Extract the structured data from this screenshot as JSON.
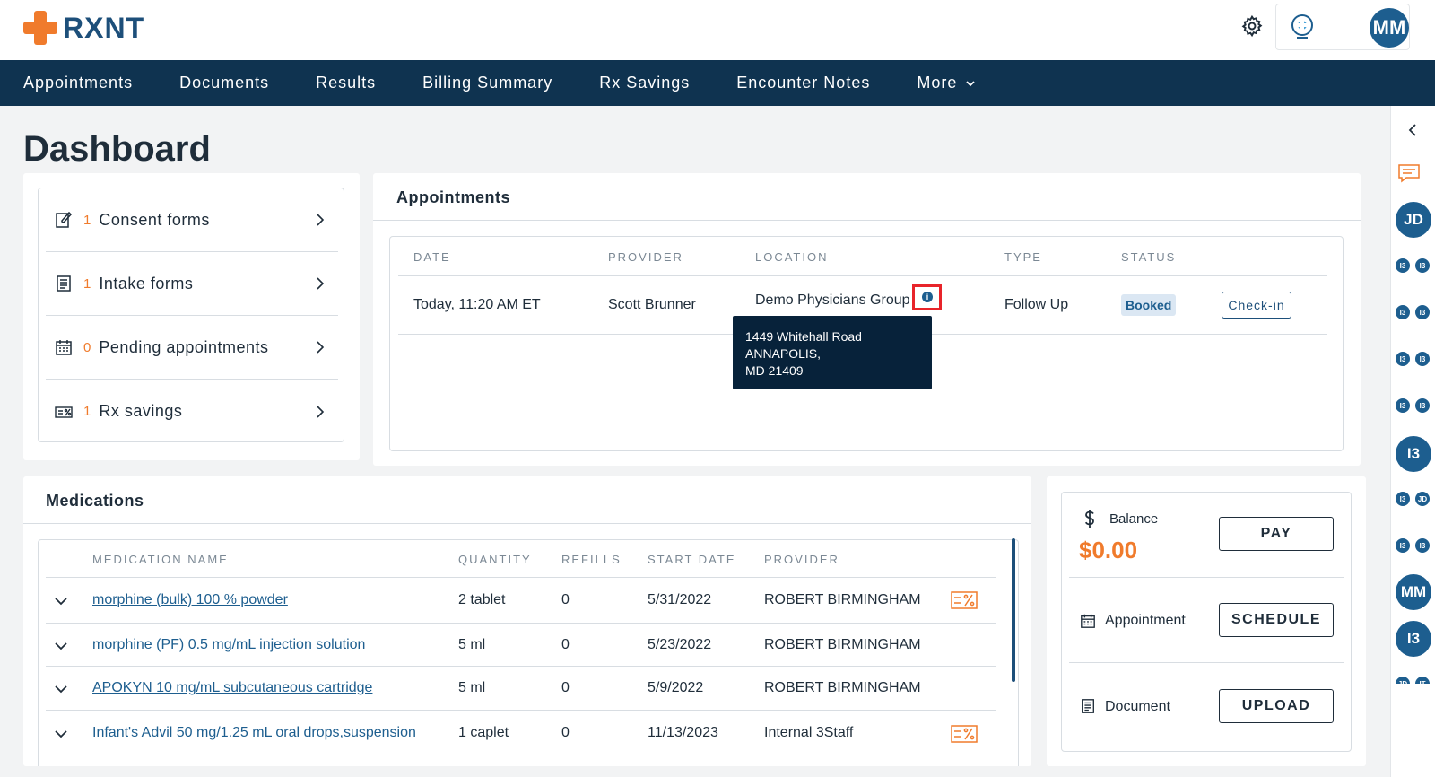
{
  "brand": {
    "name": "RXNT"
  },
  "header": {
    "avatar": "MM"
  },
  "nav": {
    "items": [
      "Appointments",
      "Documents",
      "Results",
      "Billing Summary",
      "Rx Savings",
      "Encounter Notes",
      "More"
    ]
  },
  "page": {
    "title": "Dashboard"
  },
  "quick_links": [
    {
      "count": "1",
      "label": "Consent forms",
      "icon": "consent-form-icon"
    },
    {
      "count": "1",
      "label": "Intake forms",
      "icon": "intake-form-icon"
    },
    {
      "count": "0",
      "label": "Pending appointments",
      "icon": "calendar-icon"
    },
    {
      "count": "1",
      "label": "Rx savings",
      "icon": "discount-icon"
    }
  ],
  "appointments": {
    "title": "Appointments",
    "columns": [
      "DATE",
      "PROVIDER",
      "LOCATION",
      "TYPE",
      "STATUS"
    ],
    "row": {
      "date": "Today, 11:20 AM ET",
      "provider": "Scott Brunner",
      "location": "Demo Physicians Group",
      "type": "Follow Up",
      "status": "Booked",
      "action": "Check-in"
    },
    "tooltip": [
      "1449 Whitehall Road",
      "ANNAPOLIS,",
      "MD 21409"
    ]
  },
  "medications": {
    "title": "Medications",
    "columns": [
      "MEDICATION NAME",
      "QUANTITY",
      "REFILLS",
      "START DATE",
      "PROVIDER"
    ],
    "rows": [
      {
        "name": "morphine (bulk) 100 % powder",
        "quantity": "2 tablet",
        "refills": "0",
        "start": "5/31/2022",
        "provider": "ROBERT BIRMINGHAM",
        "discount": true
      },
      {
        "name": "morphine (PF) 0.5 mg/mL injection solution",
        "quantity": "5 ml",
        "refills": "0",
        "start": "5/23/2022",
        "provider": "ROBERT BIRMINGHAM",
        "discount": false
      },
      {
        "name": "APOKYN 10 mg/mL subcutaneous cartridge",
        "quantity": "5 ml",
        "refills": "0",
        "start": "5/9/2022",
        "provider": "ROBERT BIRMINGHAM",
        "discount": false
      },
      {
        "name": "Infant's Advil 50 mg/1.25 mL oral drops,suspension",
        "quantity": "1 caplet",
        "refills": "0",
        "start": "11/13/2023",
        "provider": "Internal 3Staff",
        "discount": true
      }
    ]
  },
  "billing": {
    "balance_label": "Balance",
    "balance_value": "$0.00",
    "pay": "PAY",
    "appointment_label": "Appointment",
    "schedule": "SCHEDULE",
    "document_label": "Document",
    "upload": "UPLOAD"
  },
  "sidebar": {
    "avatars": [
      "JD",
      "I3",
      "MM",
      "I3"
    ],
    "mini": [
      "I3",
      "JD",
      "IT"
    ]
  },
  "colors": {
    "navy": "#0f3350",
    "accent": "#f07b2c",
    "primary": "#1d5e8f"
  }
}
